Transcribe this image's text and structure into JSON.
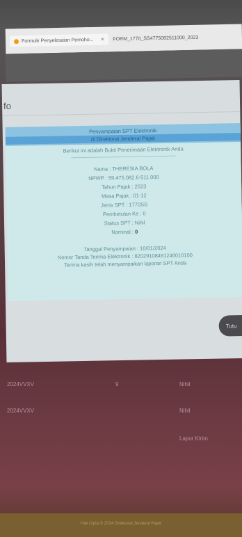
{
  "browser": {
    "tabs": [
      {
        "label": "Formulir Penyelesaian Pemoho..."
      },
      {
        "label": "FORM_1770_SS4775082511000_2023"
      }
    ],
    "close_glyph": "✕"
  },
  "modal": {
    "title": "fo",
    "notice": {
      "line1": "Penyampaian SPT Elektronik",
      "line2": "di Direktorat Jenderal Pajak",
      "line3": "Berikut ini adalah Bukti Penerimaan Elektronik Anda"
    },
    "rows": [
      "Nama : THERESIA BOLA",
      "NPWP : 59.475.082.6-511.000",
      "Tahun Pajak : 2023",
      "Masa Pajak : 01-12",
      "Jenis SPT : 1770SS",
      "Pembetulan Ke : 0",
      "Status SPT : Nihil"
    ],
    "nominal_label": "Nominal :",
    "nominal_value": "0",
    "date_line": "Tanggal Penyampaian : 10/01/2024",
    "ntte_line": "Nomor Tanda Terima Elektronik : 82029108491246010100",
    "thanks_line": "Terima kasih telah menyampaikan laporan SPT Anda",
    "close_label": "Tutu"
  },
  "background": {
    "rows": [
      {
        "c1": "2024VVXV",
        "c2": "9",
        "c3": "Nihil"
      },
      {
        "c1": "2024VVXV",
        "c2": "",
        "c3": "Nihil"
      },
      {
        "c1": "",
        "c2": "",
        "c3": "Lapor Kirim"
      }
    ],
    "footer": "Hak Cipta © 2024 Direktorat Jenderal Pajak"
  }
}
